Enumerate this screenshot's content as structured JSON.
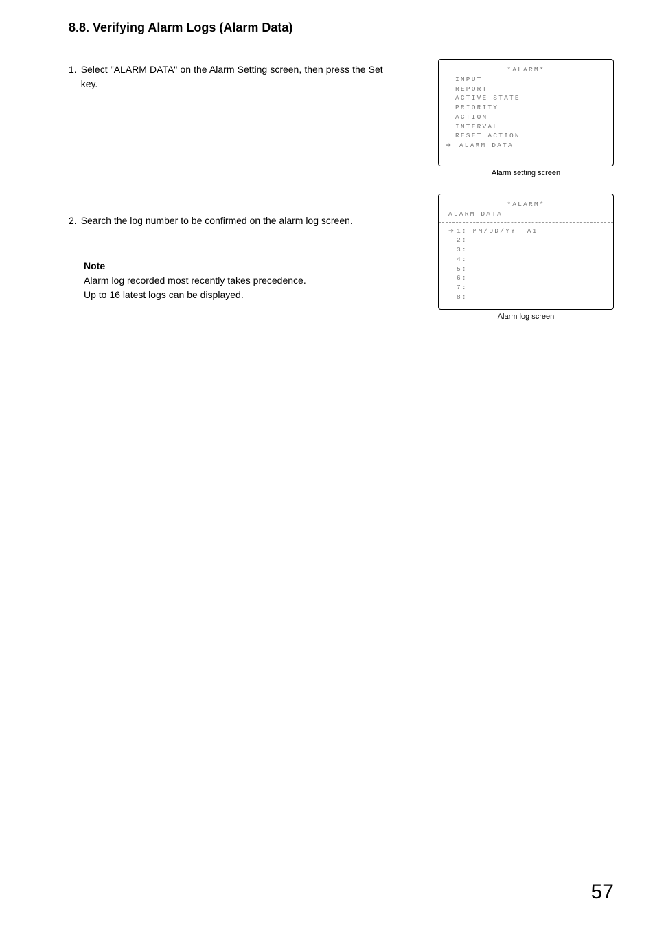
{
  "heading": "8.8. Verifying Alarm Logs (Alarm Data)",
  "steps": {
    "s1": {
      "num": "1.",
      "text": "Select \"ALARM DATA\" on the Alarm Setting screen, then press the Set key."
    },
    "s2": {
      "num": "2.",
      "text": "Search the log number to be confirmed on the alarm log screen."
    }
  },
  "note": {
    "label": "Note",
    "line1": "Alarm log recorded most recently takes precedence.",
    "line2": "Up to 16 latest logs can be displayed."
  },
  "panel1": {
    "title": "*ALARM*",
    "items": {
      "i1": "INPUT",
      "i2": "REPORT",
      "i3": "ACTIVE STATE",
      "i4": "PRIORITY",
      "i5": "ACTION",
      "i6": "INTERVAL",
      "i7": "RESET ACTION",
      "i8": "ALARM DATA"
    },
    "caption": "Alarm setting screen"
  },
  "panel2": {
    "title": "*ALARM*",
    "subtitle": "ALARM DATA",
    "rows": {
      "r1": "1: MM/DD/YY  A1",
      "r2": "2:",
      "r3": "3:",
      "r4": "4:",
      "r5": "5:",
      "r6": "6:",
      "r7": "7:",
      "r8": "8:"
    },
    "caption": "Alarm log screen"
  },
  "pageNumber": "57"
}
